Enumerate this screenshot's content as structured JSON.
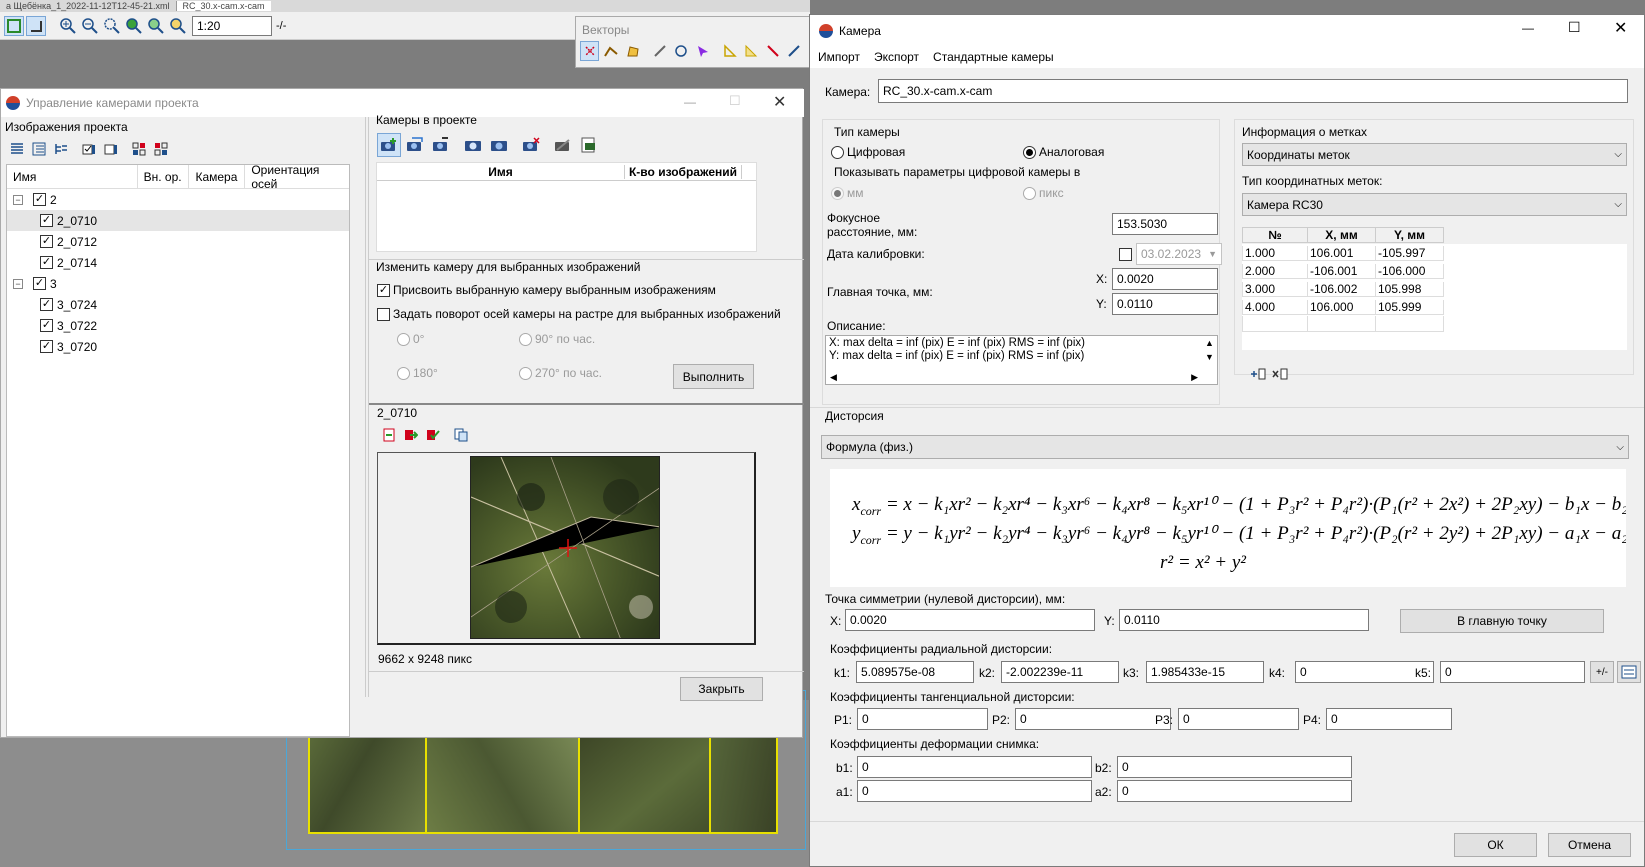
{
  "bg": {
    "tab1": "а Щебёнка_1_2022-11-12T12-45-21.xml",
    "tab2": "RC_30.x-cam.x-cam",
    "zoom": "1:20",
    "vectors_title": "Векторы"
  },
  "proj": {
    "title": "Управление камерами проекта",
    "images_header": "Изображения проекта",
    "col_name": "Имя",
    "col_io": "Вн. ор.",
    "col_cam": "Камера",
    "col_axes": "Ориентация осей",
    "tree": [
      {
        "label": "2",
        "level": 0,
        "group": true
      },
      {
        "label": "2_0710",
        "level": 1,
        "selected": true
      },
      {
        "label": "2_0712",
        "level": 1
      },
      {
        "label": "2_0714",
        "level": 1
      },
      {
        "label": "3",
        "level": 0,
        "group": true
      },
      {
        "label": "3_0724",
        "level": 1
      },
      {
        "label": "3_0722",
        "level": 1
      },
      {
        "label": "3_0720",
        "level": 1
      }
    ],
    "cams_header": "Камеры в проекте",
    "cams_col_name": "Имя",
    "cams_col_count": "К-во изображений",
    "change_header": "Изменить камеру для выбранных изображений",
    "assign_label": "Присвоить выбранную камеру выбранным изображениям",
    "rotate_label": "Задать поворот осей камеры на растре для выбранных изображений",
    "rot0": "0°",
    "rot90": "90° по час.",
    "rot180": "180°",
    "rot270": "270° по час.",
    "execute": "Выполнить",
    "preview_name": "2_0710",
    "preview_size": "9662 x 9248 пикс",
    "close": "Закрыть"
  },
  "cam": {
    "title": "Камера",
    "menu": [
      "Импорт",
      "Экспорт",
      "Стандартные камеры"
    ],
    "camera_label": "Камера:",
    "camera_value": "RC_30.x-cam.x-cam",
    "type_header": "Тип камеры",
    "digital": "Цифровая",
    "analog": "Аналоговая",
    "show_digital": "Показывать параметры цифровой камеры в",
    "mm": "мм",
    "pix": "пикс",
    "focal_label": "Фокусное расстояние, мм:",
    "focal_value": "153.5030",
    "calib_label": "Дата калибровки:",
    "calib_value": "03.02.2023",
    "pp_label": "Главная точка, мм:",
    "x_label": "X:",
    "y_label": "Y:",
    "ppx": "0.0020",
    "ppy": "0.0110",
    "desc_label": "Описание:",
    "desc_line1": "X: max delta = inf (pix) E = inf (pix) RMS = inf (pix)",
    "desc_line2": "Y: max delta = inf (pix) E = inf (pix) RMS = inf (pix)",
    "marks_header": "Информация о метках",
    "marks_select": "Координаты меток",
    "marks_type_label": "Тип координатных меток:",
    "marks_type_value": "Камера RC30",
    "marks_cols": [
      "№",
      "X, мм",
      "Y, мм"
    ],
    "marks_rows": [
      [
        "1.000",
        "106.001",
        "-105.997"
      ],
      [
        "2.000",
        "-106.001",
        "-106.000"
      ],
      [
        "3.000",
        "-106.002",
        "105.998"
      ],
      [
        "4.000",
        "106.000",
        "105.999"
      ]
    ],
    "dist_header": "Дисторсия",
    "dist_select": "Формула (физ.)",
    "sym_label": "Точка симметрии (нулевой дисторсии), мм:",
    "sym_x": "0.0020",
    "sym_y": "0.0110",
    "to_pp": "В главную точку",
    "radial_header": "Коэффициенты радиальной дисторсии:",
    "k1_label": "k1:",
    "k1": "5.089575e-08",
    "k2_label": "k2:",
    "k2": "-2.002239e-11",
    "k3_label": "k3:",
    "k3": "1.985433e-15",
    "k4_label": "k4:",
    "k4": "0",
    "k5_label": "k5:",
    "k5": "0",
    "pm": "+/-",
    "tang_header": "Коэффициенты тангенциальной дисторсии:",
    "p1_label": "P1:",
    "p1": "0",
    "p2_label": "P2:",
    "p2": "0",
    "p3_label": "P3:",
    "p3": "0",
    "p4_label": "P4:",
    "p4": "0",
    "deform_header": "Коэффициенты деформации снимка:",
    "b1_label": "b1:",
    "b1": "0",
    "b2_label": "b2:",
    "b2": "0",
    "a1_label": "a1:",
    "a1": "0",
    "a2_label": "a2:",
    "a2": "0",
    "ok": "ОК",
    "cancel": "Отмена"
  }
}
